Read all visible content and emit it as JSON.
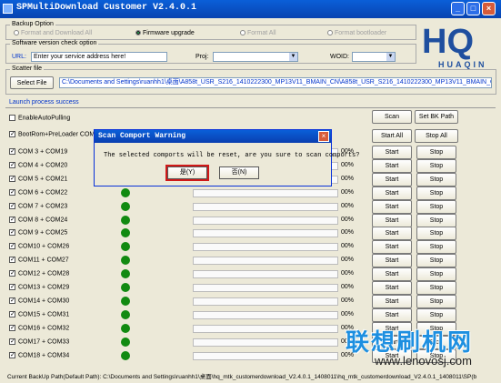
{
  "window": {
    "title": "SPMultiDownload Customer V2.4.0.1"
  },
  "backup_option": {
    "title": "Backup Option",
    "options": [
      {
        "label": "Format and Download All",
        "selected": false,
        "enabled": false
      },
      {
        "label": "Firmware upgrade",
        "selected": true,
        "enabled": true
      },
      {
        "label": "Format All",
        "selected": false,
        "enabled": false
      },
      {
        "label": "Format bootloader",
        "selected": false,
        "enabled": false
      }
    ]
  },
  "version_check": {
    "title": "Software version check option",
    "url_label": "URL:",
    "url_value": "Enter your service address here!",
    "proj_label": "Proj:",
    "proj_value": "",
    "woid_label": "WOID:",
    "woid_value": ""
  },
  "scatter": {
    "title": "Scatter file",
    "select_button": "Select File",
    "path": "C:\\Documents and Settings\\ruanhh1\\桌面\\A858t_USR_S216_1410222300_MP13V11_BMAIN_CN\\A858t_USR_S216_1410222300_MP13V11_BMAIN_CN\\"
  },
  "status": "Launch process success",
  "options": {
    "enable_auto_pulling": "EnableAutoPulling",
    "bootrom_preloader": "BootRom+PreLoader COM S"
  },
  "top_buttons": {
    "scan": "Scan",
    "set_bk_path": "Set BK Path",
    "start_all": "Start All",
    "stop_all": "Stop All"
  },
  "port_rows": [
    {
      "name": "COM 3 + COM19",
      "percent": "00%"
    },
    {
      "name": "COM 4 + COM20",
      "percent": "00%"
    },
    {
      "name": "COM 5 + COM21",
      "percent": "00%"
    },
    {
      "name": "COM 6 + COM22",
      "percent": "00%"
    },
    {
      "name": "COM 7 + COM23",
      "percent": "00%"
    },
    {
      "name": "COM 8 + COM24",
      "percent": "00%"
    },
    {
      "name": "COM 9 + COM25",
      "percent": "00%"
    },
    {
      "name": "COM10 + COM26",
      "percent": "00%"
    },
    {
      "name": "COM11 + COM27",
      "percent": "00%"
    },
    {
      "name": "COM12 + COM28",
      "percent": "00%"
    },
    {
      "name": "COM13 + COM29",
      "percent": "00%"
    },
    {
      "name": "COM14 + COM30",
      "percent": "00%"
    },
    {
      "name": "COM15 + COM31",
      "percent": "00%"
    },
    {
      "name": "COM16 + COM32",
      "percent": "00%"
    },
    {
      "name": "COM17 + COM33",
      "percent": "00%"
    },
    {
      "name": "COM18 + COM34",
      "percent": "00%"
    }
  ],
  "row_buttons": {
    "start": "Start",
    "stop": "Stop"
  },
  "footer": "Current BackUp Path(Default Path):  C:\\Documents and Settings\\ruanhh1\\桌面\\hq_mtk_customerdownload_V2.4.0.1_1408011\\hq_mtk_customerdownload_V2.4.0.1_1408011\\SP(b",
  "logo": {
    "letters": "HQ",
    "sub": "HUAQIN",
    "color": "#1f4f9f"
  },
  "watermark": {
    "text": "联想刷机网",
    "url": "www.lenovosj.com"
  },
  "dialog": {
    "title": "Scan Comport Warning",
    "message": "The selected comports will be reset, are you sure to scan comports?",
    "yes": "是(Y)",
    "no": "否(N)"
  },
  "colors": {
    "titlebar": "#0a5fd8",
    "led": "#118a11",
    "status": "#0033cc",
    "highlight": "#d01818"
  }
}
